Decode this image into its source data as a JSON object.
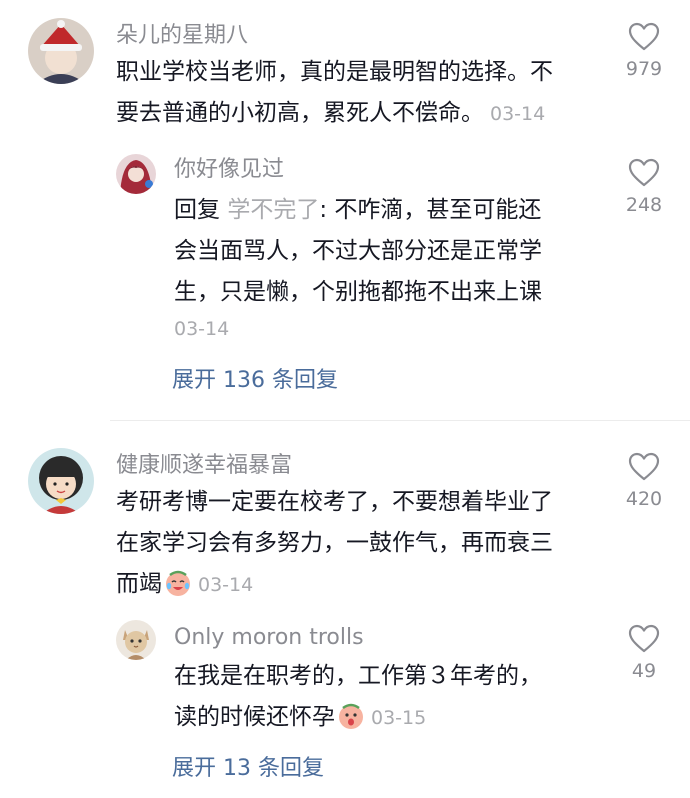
{
  "comments": [
    {
      "username": "朵儿的星期八",
      "lines": [
        "职业学校当老师，真的是最明智的选择。不",
        "要去普通的小初高，累死人不偿命。"
      ],
      "date": "03-14",
      "likes": "979",
      "reply": {
        "username": "你好像见过",
        "reply_prefix": "回复",
        "reply_target": "学不完了",
        "lines": [
          ": 不咋滴，甚至可能还",
          "会当面骂人，不过大部分还是正常学",
          "生，只是懒，个别拖都拖不出来上课"
        ],
        "date": "03-14",
        "likes": "248"
      },
      "expand": "展开 136 条回复"
    },
    {
      "username": "健康顺遂幸福暴富",
      "lines": [
        "考研考博一定要在校考了，不要想着毕业了",
        "在家学习会有多努力，一鼓作气，再而衰三",
        "而竭"
      ],
      "date": "03-14",
      "likes": "420",
      "reply": {
        "username": "Only moron trolls",
        "lines": [
          "在我是在职考的，工作第３年考的，",
          "读的时候还怀孕"
        ],
        "date": "03-15",
        "likes": "49"
      },
      "expand": "展开 13 条回复"
    }
  ],
  "icons": {
    "like": "heart-outline-icon",
    "emoji_1": "crying-laughing-emoji-icon",
    "emoji_2": "surprised-emoji-icon"
  }
}
